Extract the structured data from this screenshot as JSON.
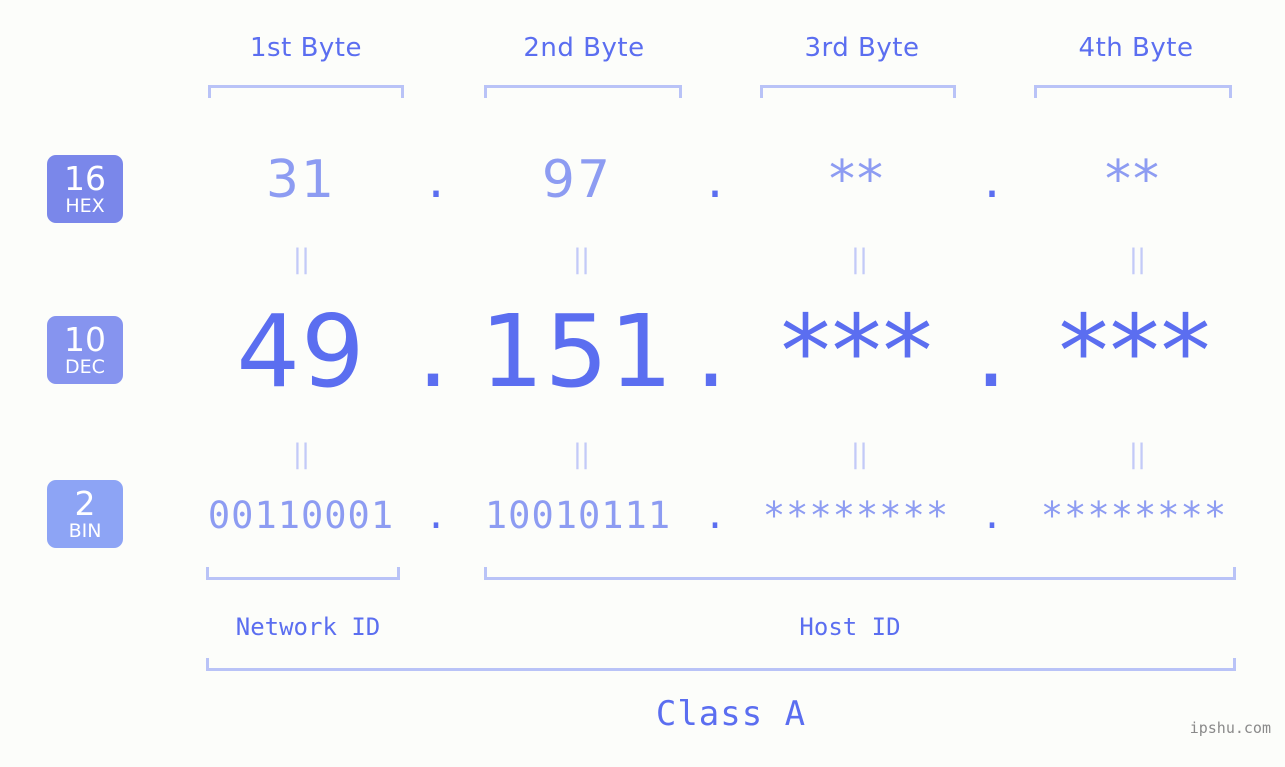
{
  "meta": {
    "background_color": "#fcfdfa",
    "accent_color": "#5b6ef0",
    "accent_light_color": "#8d9cf2",
    "bracket_color": "#b9c3f7",
    "watermark": "ipshu.com"
  },
  "byte_headers": [
    {
      "label": "1st Byte"
    },
    {
      "label": "2nd Byte"
    },
    {
      "label": "3rd Byte"
    },
    {
      "label": "4th Byte"
    }
  ],
  "bases": [
    {
      "number": "16",
      "name": "HEX",
      "color": "#7a87ea"
    },
    {
      "number": "10",
      "name": "DEC",
      "color": "#8694ef"
    },
    {
      "number": "2",
      "name": "BIN",
      "color": "#8da4f5"
    }
  ],
  "rows": {
    "hex": {
      "values": [
        "31",
        "97",
        "**",
        "**"
      ],
      "separator": "."
    },
    "dec": {
      "values": [
        "49",
        "151",
        "***",
        "***"
      ],
      "separator": "."
    },
    "bin": {
      "values": [
        "00110001",
        "10010111",
        "********",
        "********"
      ],
      "separator": "."
    }
  },
  "equals_symbol": "=",
  "sections": {
    "network_id": "Network ID",
    "host_id": "Host ID",
    "class": "Class A"
  }
}
